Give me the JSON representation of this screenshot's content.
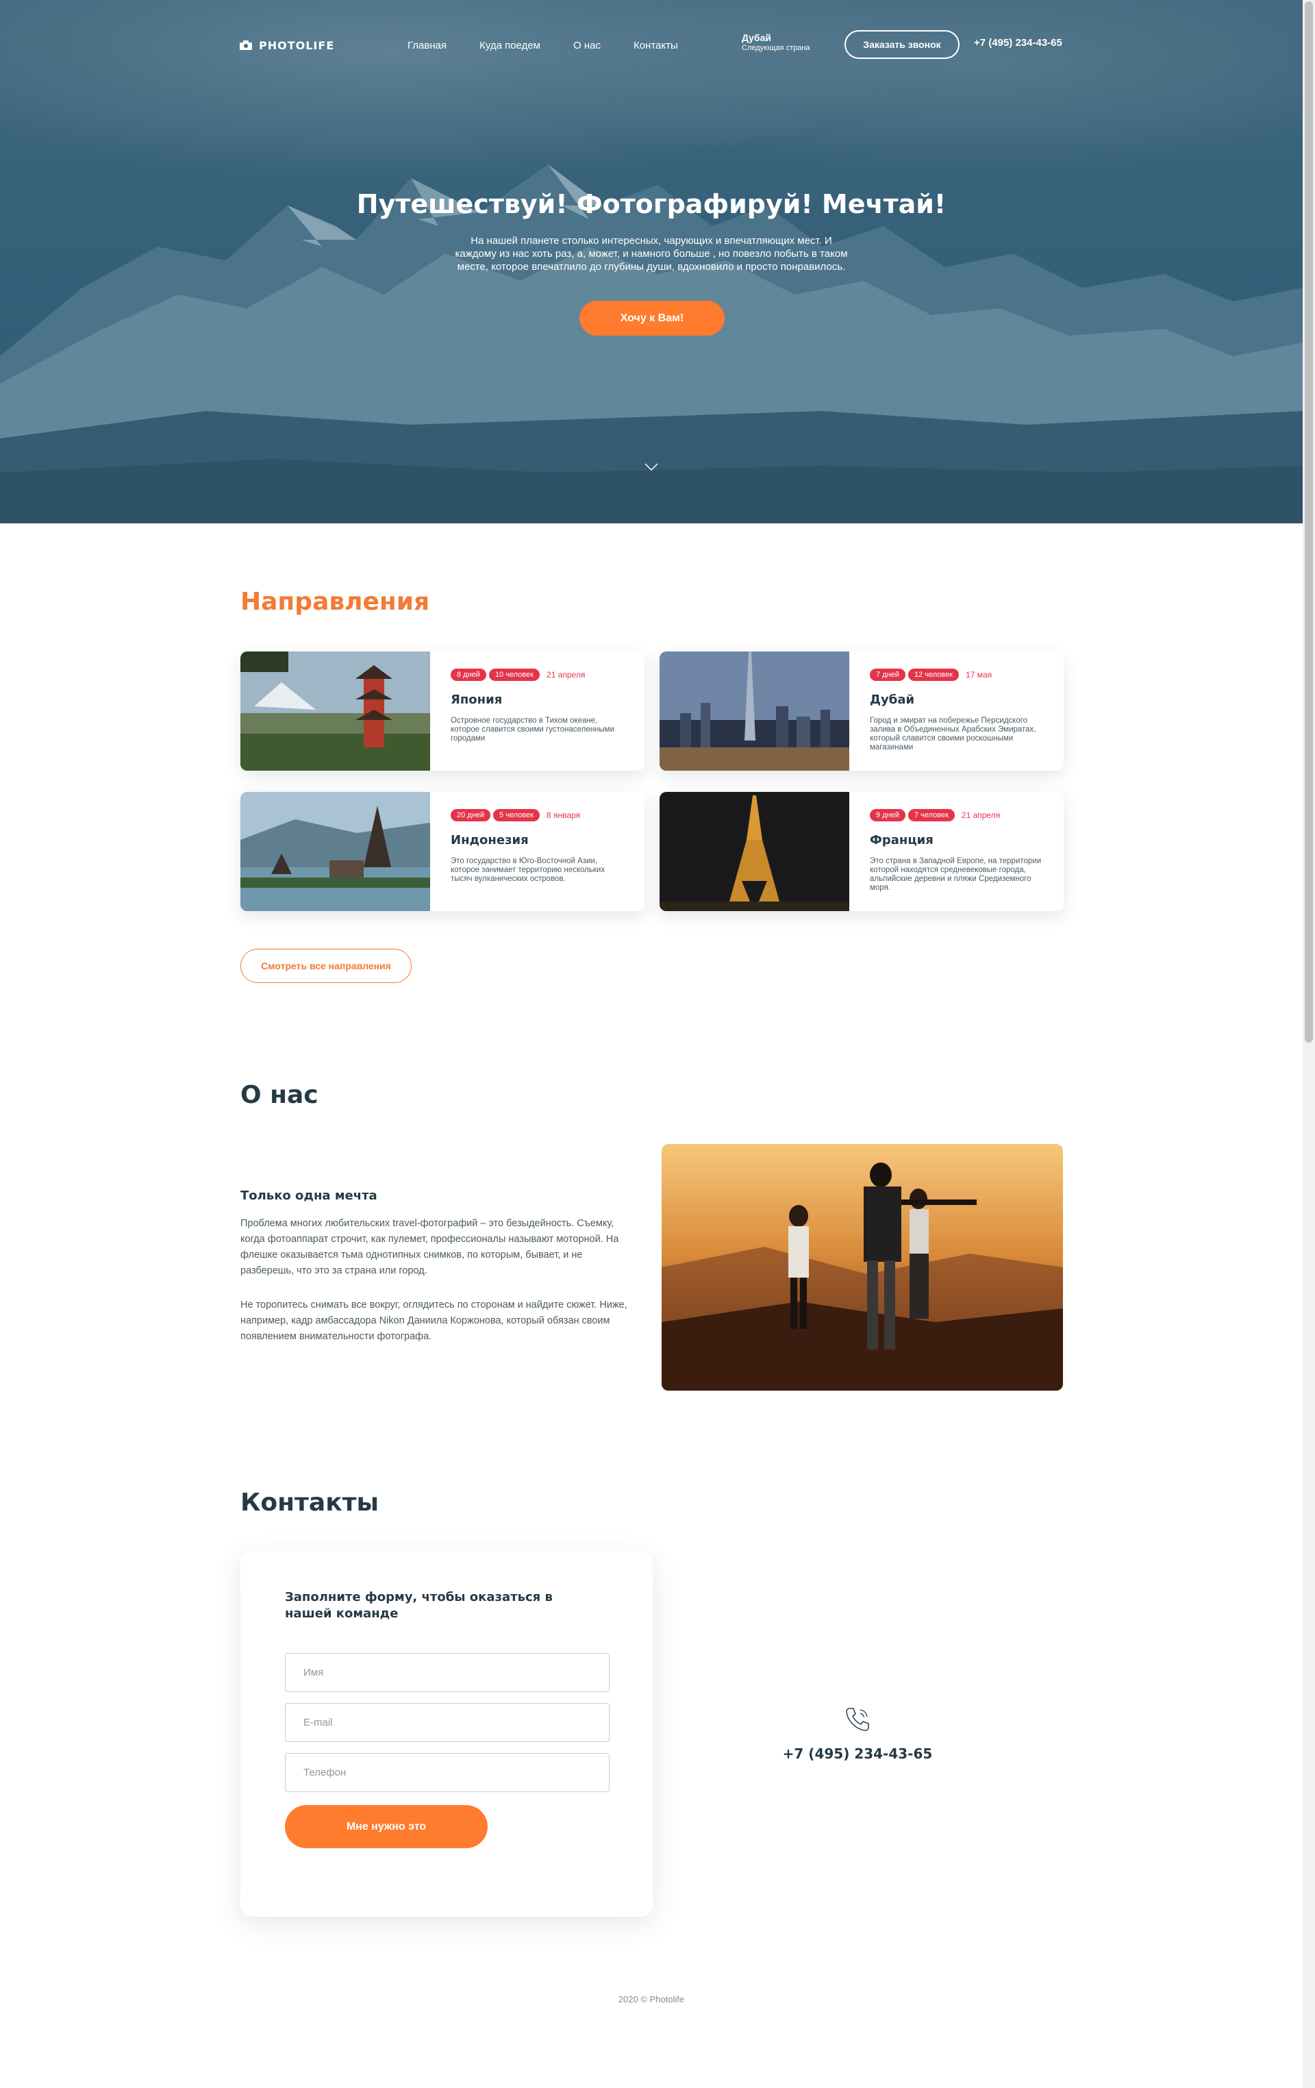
{
  "header": {
    "logo": "PHOTOLIFE",
    "menu": [
      "Главная",
      "Куда поедем",
      "О нас",
      "Контакты"
    ],
    "next_country": "Дубай",
    "next_label": "Следующая страна",
    "call_button": "Заказать звонок",
    "phone": "+7 (495) 234-43-65"
  },
  "hero": {
    "title": "Путешествуй! Фотографируй! Мечтай!",
    "text": "На нашей планете столько интересных, чарующих и впечатляющих мест. И каждому из нас хоть раз, а, может, и намного больше , но повезло побыть в таком месте, которое впечатлило до глубины души, вдохновило и просто понравилось.",
    "button": "Хочу к Вам!"
  },
  "directions": {
    "title": "Направления",
    "cards": [
      {
        "days": "8 дней",
        "people": "10 человек",
        "date": "21 апреля",
        "title": "Япония",
        "text": "Островное государство в Тихом океане, которое славится своими густонаселенными городами"
      },
      {
        "days": "7 дней",
        "people": "12 человек",
        "date": "17 мая",
        "title": "Дубай",
        "text": "Город и эмират на побережье Персидского залива в Объединенных Арабских Эмиратах, который славится своими роскошными магазинами"
      },
      {
        "days": "20 дней",
        "people": "5 человек",
        "date": "8 января",
        "title": "Индонезия",
        "text": "Это государство в Юго-Восточной Азии, которое занимает территорию нескольких тысяч вулканических островов."
      },
      {
        "days": "9 дней",
        "people": "7 человек",
        "date": "21 апреля",
        "title": "Франция",
        "text": "Это страна в Западной Европе, на территории которой находятся средневековые города, альпийские деревни и пляжи Средиземного моря."
      }
    ],
    "all_button": "Смотреть все направления"
  },
  "about": {
    "title": "О нас",
    "subtitle": "Только одна мечта",
    "p1": "Проблема многих любительских travel-фотографий – это безыдейность. Съемку, когда фотоаппарат строчит, как пулемет, профессионалы называют моторной. На флешке оказывается тьма однотипных снимков, по которым, бывает, и не разберешь, что это за страна или город.",
    "p2": "Не торопитесь снимать все вокруг, оглядитесь по сторонам и найдите сюжет. Ниже, например, кадр амбассадора Nikon Даниила Коржонова, который обязан своим появлением внимательности фотографа."
  },
  "contacts": {
    "title": "Контакты",
    "form_title": "Заполните форму, чтобы оказаться в нашей команде",
    "name_placeholder": "Имя",
    "email_placeholder": "E-mail",
    "phone_placeholder": "Телефон",
    "submit": "Мне нужно это",
    "phone": "+7 (495) 234-43-65"
  },
  "footer": {
    "text": "2020 © Photolife"
  },
  "colors": {
    "accent": "#ff7b2e",
    "tag": "#e43449",
    "heading": "#263a45",
    "orange_heading": "#f27b35"
  }
}
